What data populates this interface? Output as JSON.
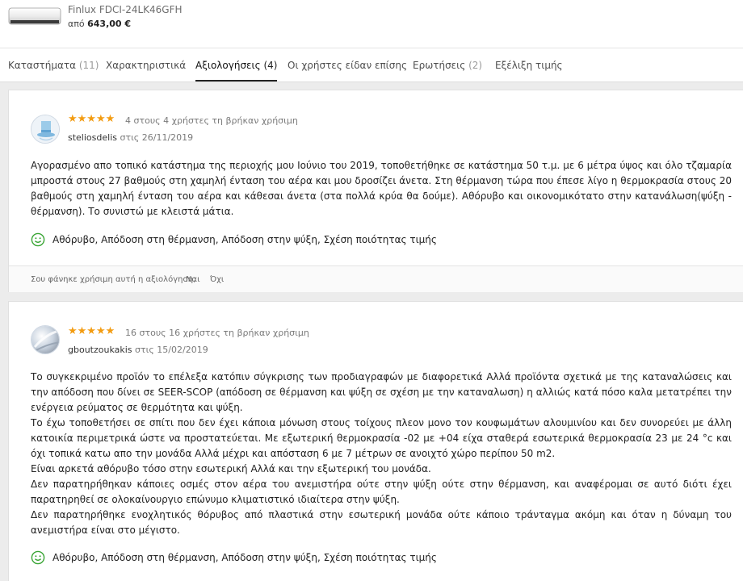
{
  "product": {
    "name": "Finlux FDCI-24LK46GFH",
    "price_prefix": "από",
    "price": "643,00 €"
  },
  "tabs": [
    {
      "label": "Καταστήματα",
      "count": "(11)"
    },
    {
      "label": "Χαρακτηριστικά",
      "count": ""
    },
    {
      "label": "Αξιολογήσεις",
      "count": "(4)"
    },
    {
      "label": "Οι χρήστες είδαν επίσης",
      "count": ""
    },
    {
      "label": "Ερωτήσεις",
      "count": "(2)"
    },
    {
      "label": "Εξέλιξη τιμής",
      "count": ""
    }
  ],
  "active_tab": "Αξιολογήσεις",
  "reviews": [
    {
      "rating": 5,
      "stars": "★★★★★",
      "helpful": "4 στους 4 χρήστες τη βρήκαν χρήσιμη",
      "username": "steliosdelis",
      "date": "στις 26/11/2019",
      "text": "Αγορασμένο απο τοπικό κατάστημα της περιοχής μου Ιούνιο του 2019, τοποθετήθηκε σε κατάστημα 50 τ.μ. με 6 μέτρα ύψος και όλο τζαμαρία μπροστά στους 27 βαθμούς στη χαμηλή ένταση του αέρα και μου δροσίζει άνετα. Στη θέρμανση τώρα που έπεσε λίγο η θερμοκρασία στους 20 βαθμούς στη χαμηλή ένταση του αέρα και κάθεσαι άνετα (στα πολλά κρύα θα δούμε). Αθόρυβο και οικονομικότατο στην κατανάλωση(ψύξη - θέρμανση). Το συνιστώ με κλειστά μάτια.",
      "pros": "Αθόρυβο, Απόδοση στη θέρμανση, Απόδοση στην ψύξη, Σχέση ποιότητας τιμής",
      "feedback_question": "Σου φάνηκε χρήσιμη αυτή η αξιολόγηση;",
      "yes_label": "Ναι",
      "no_label": "Όχι"
    },
    {
      "rating": 5,
      "stars": "★★★★★",
      "helpful": "16 στους 16 χρήστες τη βρήκαν χρήσιμη",
      "username": "gboutzoukakis",
      "date": "στις 15/02/2019",
      "paragraphs": [
        "Το συγκεκριμένο προϊόν το επέλεξα κατόπιν σύγκρισης των προδιαγραφών με διαφορετικά Αλλά προϊόντα σχετικά με της καταναλώσεις και την απόδοση που δίνει σε SEER-SCOP (απόδοση σε θέρμανση και ψύξη σε σχέση με την καταναλωση) η αλλιώς κατά πόσο καλα μετατρέπει την ενέργεια ρεύματος σε θερμότητα και ψύξη.",
        "Το έχω τοποθετήσει σε σπίτι που δεν έχει κάποια μόνωση στους τοίχους πλεον μονο τον κουφωμάτων αλουμινίου και δεν συνορεύει με άλλη κατοικία περιμετρικά ώστε να προστατεύεται. Με εξωτερική θερμοκρασία -02 με +04 είχα σταθερά εσωτερικά θερμοκρασία 23 με 24 °c και όχι τοπικά κατω απο την μονάδα Αλλά μέχρι και απόσταση 6 με 7 μέτρων σε ανοιχτό χώρο περίπου 50 m2.",
        "Είναι αρκετά αθόρυβο τόσο στην εσωτερική Αλλά και την εξωτερική του μονάδα.",
        "Δεν παρατηρήθηκαν κάποιες οσμές στον αέρα του ανεμιστήρα ούτε στην ψύξη ούτε στην θέρμανση, και αναφέρομαι σε αυτό διότι έχει παρατηρηθεί σε ολοκαίνουργιο επώνυμο κλιματιστικό ιδιαίτερα στην ψύξη.",
        "Δεν παρατηρήθηκε ενοχλητικός θόρυβος από πλαστικά στην εσωτερική μονάδα ούτε κάποιο τράνταγμα ακόμη και όταν η δύναμη του ανεμιστήρα είναι στο μέγιστο."
      ],
      "pros": "Αθόρυβο, Απόδοση στη θέρμανση, Απόδοση στην ψύξη, Σχέση ποιότητας τιμής"
    }
  ]
}
